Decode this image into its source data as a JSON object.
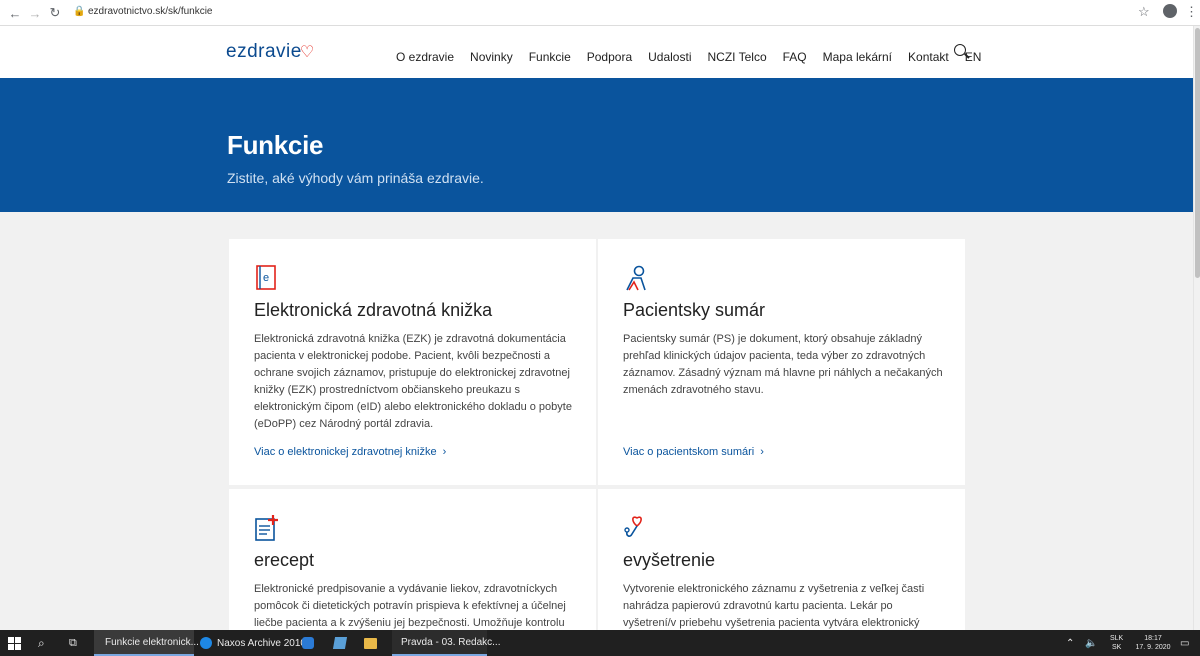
{
  "browser": {
    "url": "ezdravotnictvo.sk/sk/funkcie"
  },
  "site": {
    "logo_text": "ezdravie",
    "nav": [
      "O ezdravie",
      "Novinky",
      "Funkcie",
      "Podpora",
      "Udalosti",
      "NCZI Telco",
      "FAQ",
      "Mapa lekární",
      "Kontakt",
      "EN"
    ]
  },
  "hero": {
    "title": "Funkcie",
    "subtitle": "Zistite, aké výhody vám prináša ezdravie."
  },
  "cards": [
    {
      "icon": "book-icon",
      "title": "Elektronická zdravotná knižka",
      "description": "Elektronická zdravotná knižka (EZK) je zdravotná dokumentácia pacienta v elektronickej podobe. Pacient, kvôli bezpečnosti a ochrane svojich záznamov, pristupuje do elektronickej zdravotnej knižky (EZK) prostredníctvom občianskeho preukazu s elektronickým čipom (eID) alebo elektronického dokladu o pobyte (eDoPP) cez Národný portál zdravia.",
      "link": "Viac o elektronickej zdravotnej knižke"
    },
    {
      "icon": "patient-icon",
      "title": "Pacientsky sumár",
      "description": "Pacientsky sumár (PS) je dokument, ktorý obsahuje základný prehľad klinických údajov pacienta, teda výber zo zdravotných záznamov. Zásadný význam má hlavne pri náhlych a nečakaných zmenách zdravotného stavu.",
      "link": "Viac o pacientskom sumári"
    },
    {
      "icon": "prescription-icon",
      "title": "erecept",
      "description": "Elektronické predpisovanie a vydávanie liekov, zdravotníckych pomôcok či dietetických potravín prispieva k efektívnej a účelnej liečbe pacienta a k zvýšeniu jej bezpečnosti. Umožňuje kontrolu"
    },
    {
      "icon": "stethoscope-icon",
      "title": "evyšetrenie",
      "description": "Vytvorenie elektronického záznamu z vyšetrenia z veľkej časti nahrádza papierovú zdravotnú kartu pacienta. Lekár po vyšetrení/v priebehu vyšetrenia pacienta vytvára elektronický"
    }
  ],
  "taskbar": {
    "chrome_label": "Funkcie elektronick...",
    "edge_label": "Naxos Archive 2010...",
    "pravda_label": "Pravda - 03. Redakc...",
    "lang_top": "SLK",
    "lang_bottom": "SK",
    "time": "18:17",
    "date": "17. 9. 2020"
  },
  "colors": {
    "brand_blue": "#0a549d",
    "brand_red": "#e2231a"
  }
}
